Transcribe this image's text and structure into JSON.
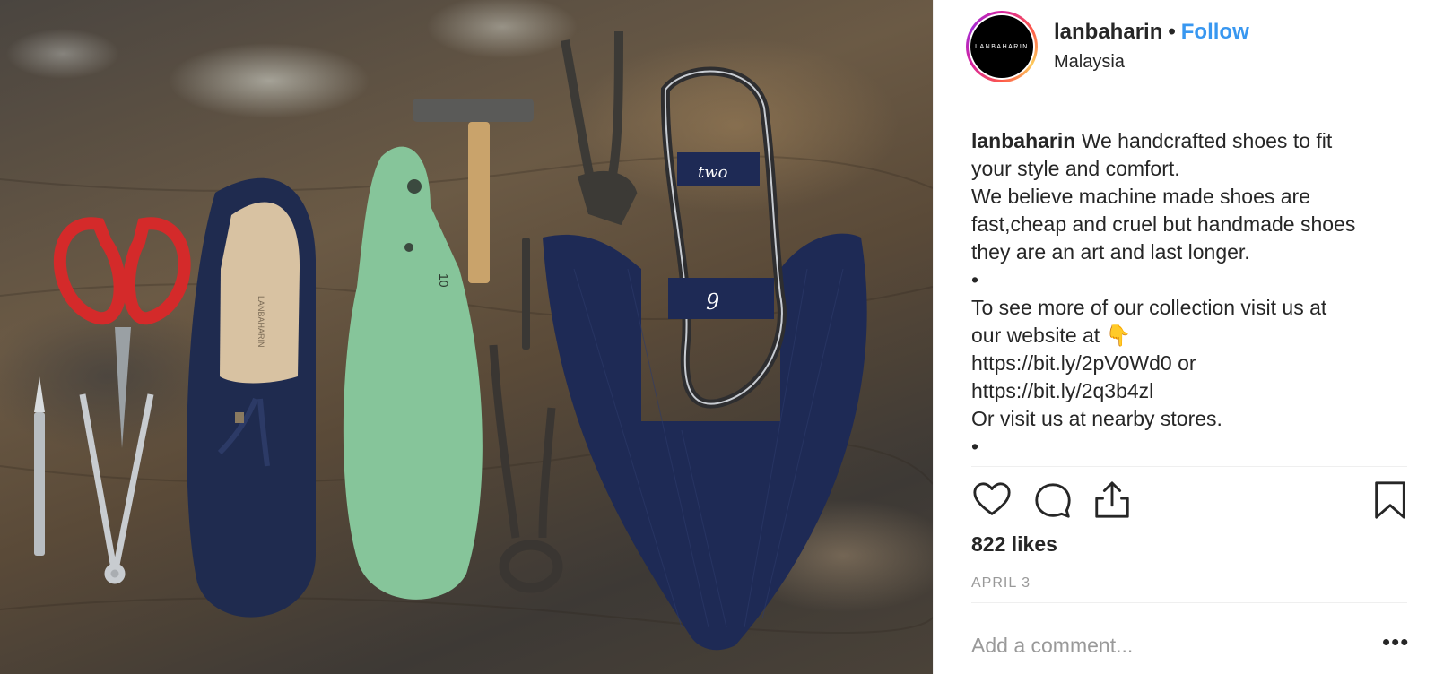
{
  "post": {
    "username": "lanbaharin",
    "separator": "•",
    "follow_label": "Follow",
    "location": "Malaysia",
    "avatar_text": "LANBAHARIN",
    "photo_alt": "Shoemaking tools and navy tassel loafer on wooden workbench",
    "shoe_labels": {
      "insole": "LANBAHARIN",
      "last_number": "10",
      "template_top": "two",
      "template_bottom": "9"
    }
  },
  "caption": {
    "username": "lanbaharin",
    "lines": [
      "We handcrafted shoes to fit",
      "your style and comfort.",
      "We believe machine made shoes are",
      "fast,cheap and cruel but handmade shoes",
      "they are an art and last longer.",
      "•",
      "To see more of our collection visit us at",
      "our website at 👇",
      "https://bit.ly/2pV0Wd0 or",
      "https://bit.ly/2q3b4zl",
      "Or visit us at nearby stores.",
      "•"
    ]
  },
  "actions": {
    "like_icon": "heart-icon",
    "comment_icon": "comment-bubble-icon",
    "share_icon": "share-upload-icon",
    "save_icon": "bookmark-icon"
  },
  "likes": "822 likes",
  "date": "APRIL 3",
  "comment": {
    "placeholder": "Add a comment...",
    "more_label": "•••"
  },
  "colors": {
    "link_blue": "#3897f0",
    "text": "#262626",
    "muted": "#999999",
    "divider": "#efefef"
  }
}
